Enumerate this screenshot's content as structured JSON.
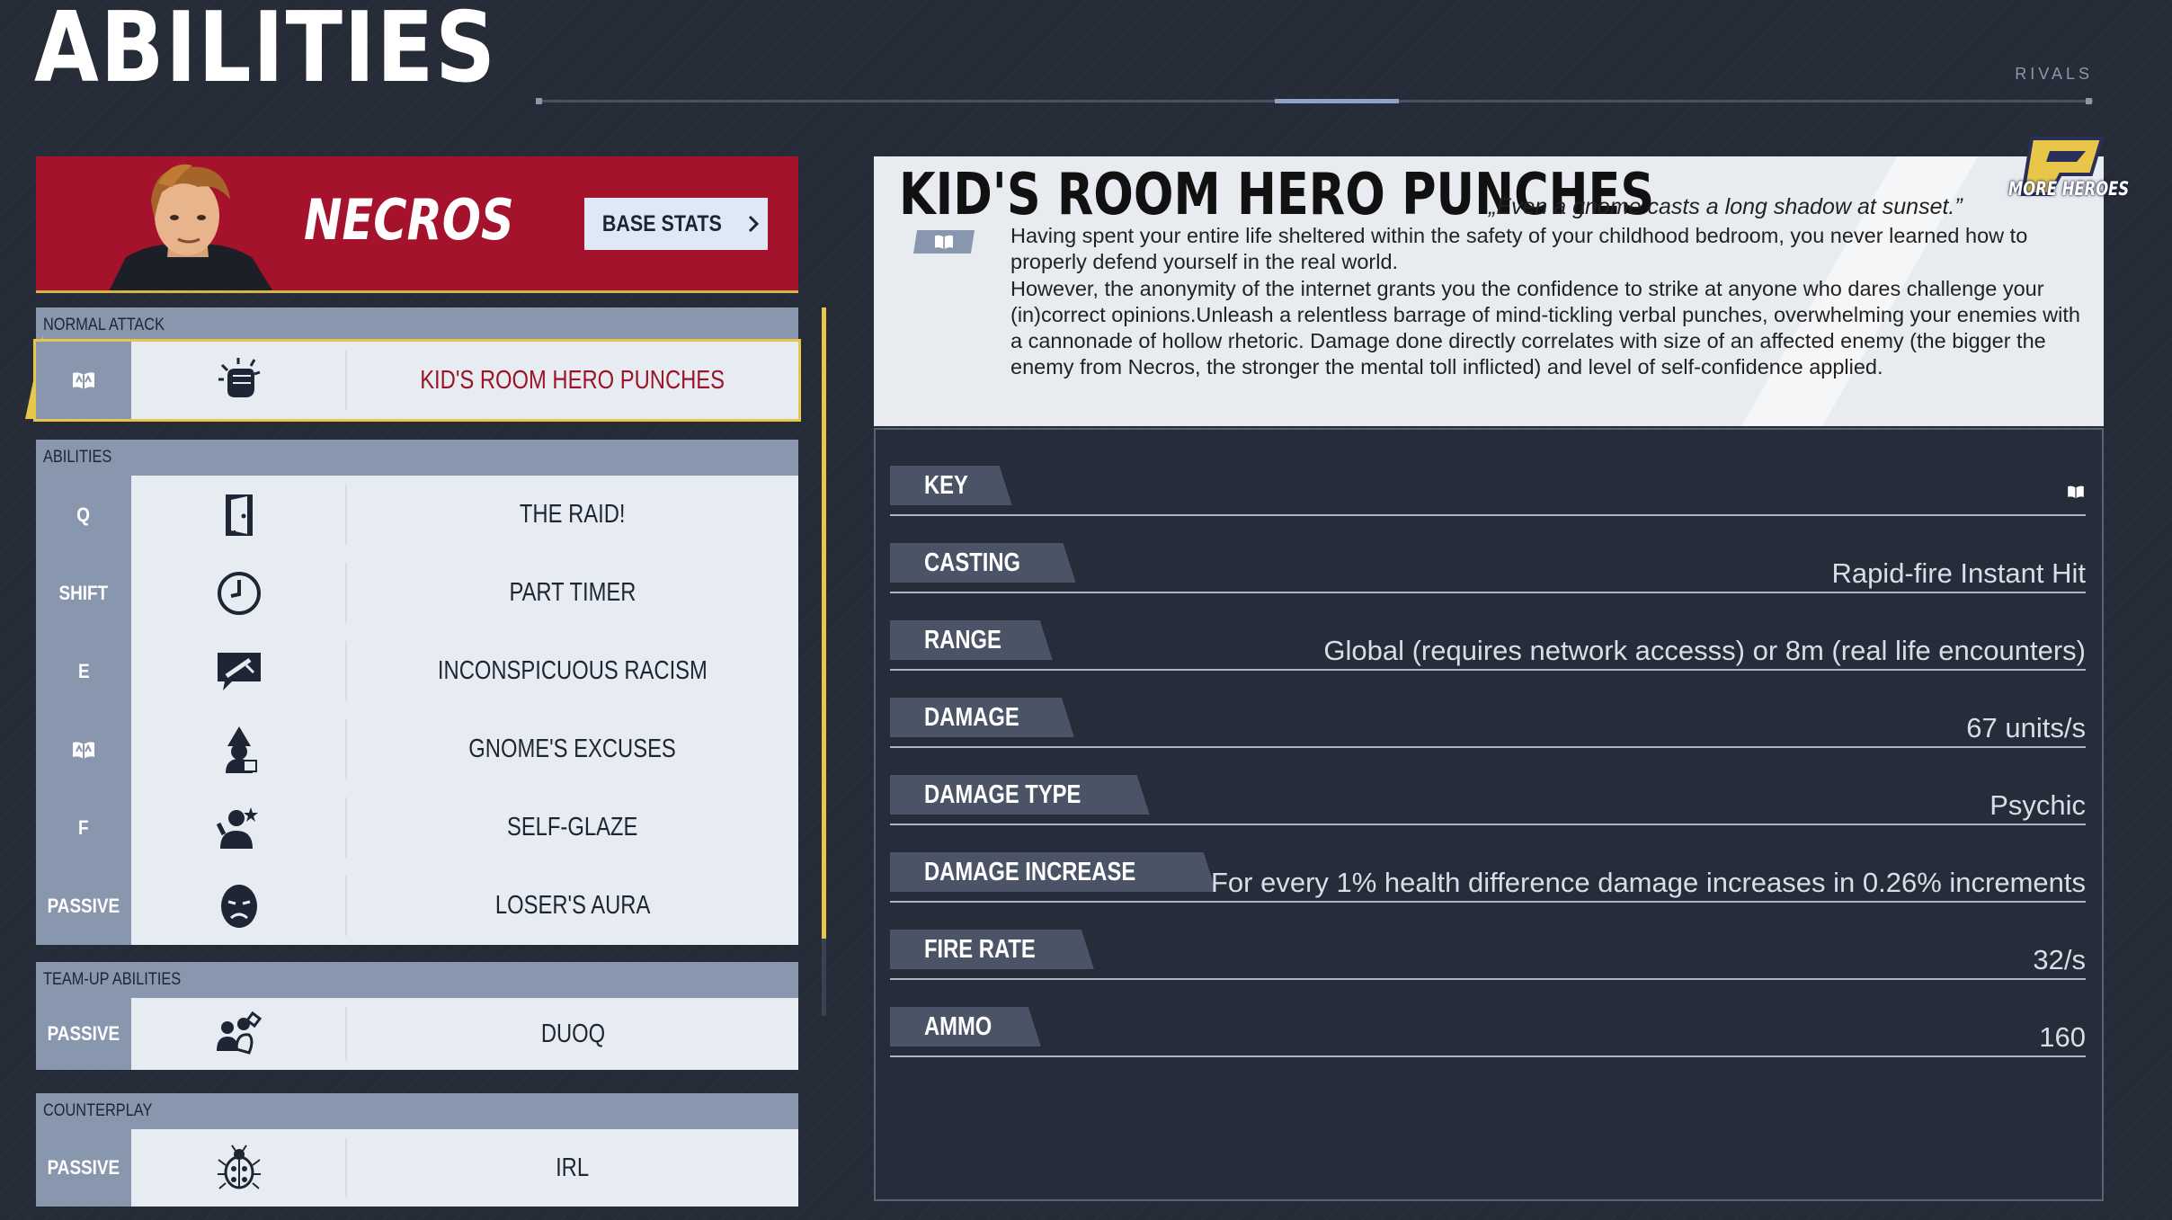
{
  "page": {
    "title": "ABILITIES",
    "brand": "RIVALS"
  },
  "hero": {
    "name": "NECROS",
    "base_stats_label": "BASE STATS"
  },
  "sections": {
    "normal_attack": {
      "label": "NORMAL ATTACK",
      "rows": [
        {
          "key": "book-key-icon",
          "icon": "punch-fist-icon",
          "name": "KID'S ROOM HERO PUNCHES",
          "selected": true
        }
      ]
    },
    "abilities": {
      "label": "ABILITIES",
      "rows": [
        {
          "key": "Q",
          "icon": "door-icon",
          "name": "THE RAID!"
        },
        {
          "key": "SHIFT",
          "icon": "clock-icon",
          "name": "PART TIMER"
        },
        {
          "key": "E",
          "icon": "speech-knife-icon",
          "name": "INCONSPICUOUS RACISM"
        },
        {
          "key": "book-key-icon",
          "icon": "gnome-icon",
          "name": "GNOME'S EXCUSES"
        },
        {
          "key": "F",
          "icon": "self-glaze-icon",
          "name": "SELF-GLAZE"
        },
        {
          "key": "PASSIVE",
          "icon": "sad-face-icon",
          "name": "LOSER'S AURA"
        }
      ]
    },
    "team_up": {
      "label": "TEAM-UP ABILITIES",
      "rows": [
        {
          "key": "PASSIVE",
          "icon": "team-icon",
          "name": "DUOQ"
        }
      ]
    },
    "counterplay": {
      "label": "COUNTERPLAY",
      "rows": [
        {
          "key": "PASSIVE",
          "icon": "bug-icon",
          "name": "IRL"
        }
      ]
    }
  },
  "detail": {
    "title": "KID'S ROOM HERO PUNCHES",
    "quote": "„Even a gnome casts a long shadow at sunset.”",
    "description": [
      "Having spent your entire life sheltered within the safety of your childhood bedroom, you never learned how to properly defend yourself in the real world.",
      "However, the anonymity of the internet grants you the confidence to strike at anyone who dares challenge your (in)correct opinions.Unleash a relentless barrage of mind-tickling verbal punches, overwhelming your enemies with a cannonade of hollow rhetoric. Damage done directly correlates with size of an affected enemy (the bigger the enemy from Necros, the stronger the mental toll inflicted) and level of self-confidence applied."
    ],
    "stats": [
      {
        "label": "KEY",
        "value": ""
      },
      {
        "label": "CASTING",
        "value": "Rapid-fire Instant Hit"
      },
      {
        "label": "RANGE",
        "value": "Global (requires network accesss) or 8m (real life encounters)"
      },
      {
        "label": "DAMAGE",
        "value": "67 units/s"
      },
      {
        "label": "DAMAGE TYPE",
        "value": "Psychic"
      },
      {
        "label": "DAMAGE INCREASE",
        "value": "For every 1% health difference damage increases in 0.26% increments"
      },
      {
        "label": "FIRE RATE",
        "value": "32/s"
      },
      {
        "label": "AMMO",
        "value": "160"
      }
    ]
  },
  "more_heroes": {
    "label": "MORE HEROES"
  },
  "colors": {
    "accent_yellow": "#e8c64a",
    "banner_red": "#a4122c",
    "key_blue": "#8896ae"
  }
}
